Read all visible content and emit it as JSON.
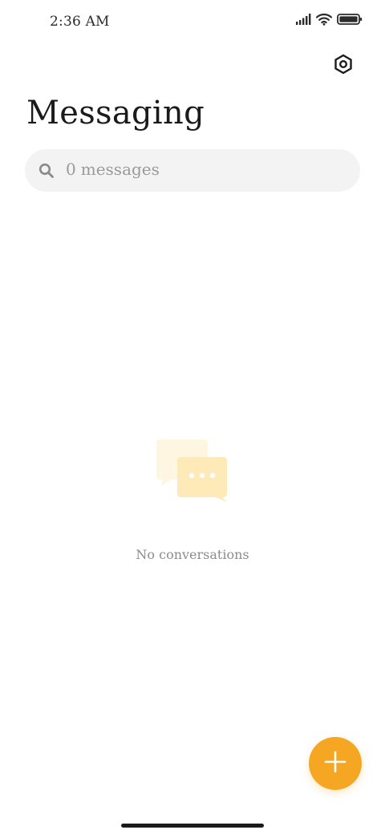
{
  "status_bar": {
    "time": "2:36 AM",
    "icons": [
      "signal-icon",
      "wifi-icon",
      "battery-icon"
    ]
  },
  "header": {
    "settings_icon": "settings-icon",
    "title": "Messaging"
  },
  "search": {
    "count": "0",
    "label": "messages",
    "icon": "search-icon"
  },
  "empty_state": {
    "icon": "chat-bubbles-icon",
    "text": "No conversations"
  },
  "fab": {
    "icon": "plus-icon"
  },
  "colors": {
    "accent": "#F5A623",
    "bubble_back": "#FFF6E1",
    "bubble_front": "#FEE9B8",
    "search_bg": "#F3F3F3",
    "muted_text": "#8C8C8C"
  }
}
